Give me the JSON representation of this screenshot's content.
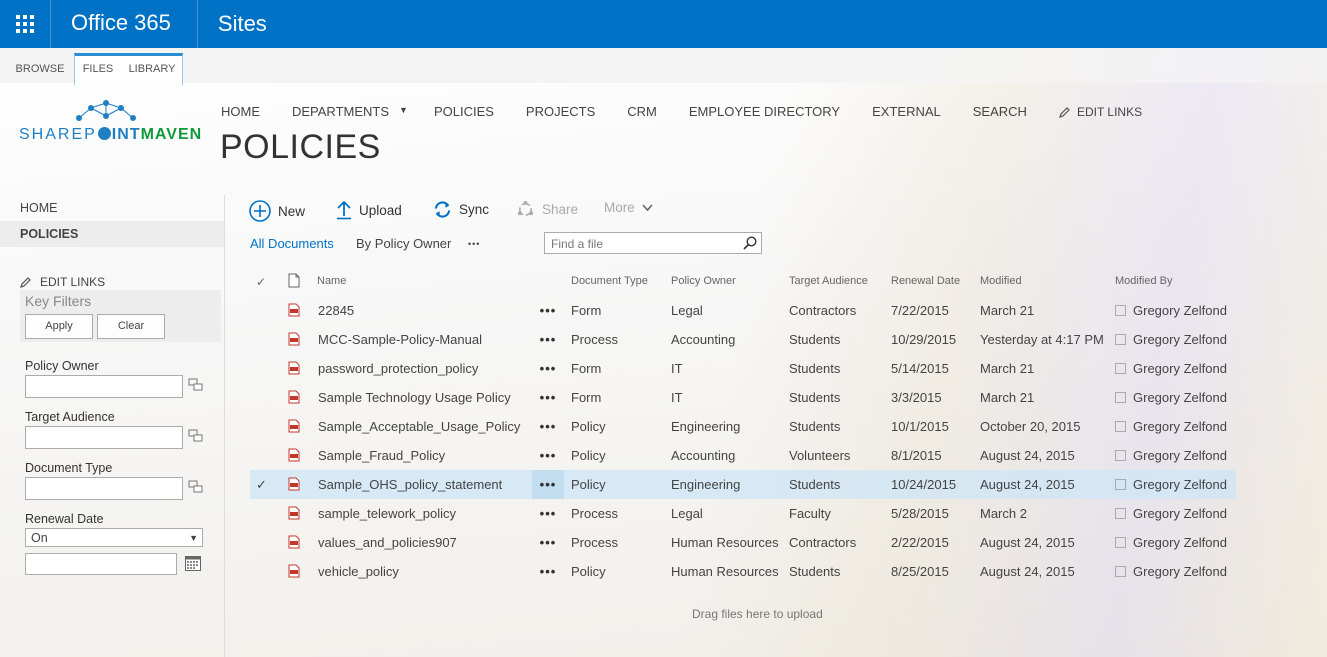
{
  "suite": {
    "brand": "Office 365",
    "app": "Sites"
  },
  "ribbon": {
    "tabs": [
      "BROWSE",
      "FILES",
      "LIBRARY"
    ]
  },
  "logo": {
    "part1": "SHAREP",
    "part2": "INT",
    "part3": "MAVEN"
  },
  "topnav": {
    "items": [
      "HOME",
      "DEPARTMENTS",
      "POLICIES",
      "PROJECTS",
      "CRM",
      "EMPLOYEE DIRECTORY",
      "EXTERNAL",
      "SEARCH"
    ],
    "edit_links": "EDIT LINKS"
  },
  "page_title": "POLICIES",
  "leftnav": {
    "items": [
      "HOME",
      "POLICIES"
    ],
    "edit_links": "EDIT LINKS"
  },
  "key_filters": {
    "title": "Key Filters",
    "apply": "Apply",
    "clear": "Clear",
    "policy_owner": "Policy Owner",
    "target_audience": "Target Audience",
    "document_type": "Document Type",
    "renewal_date": "Renewal Date",
    "renewal_operator": "On"
  },
  "commands": {
    "new": "New",
    "upload": "Upload",
    "sync": "Sync",
    "share": "Share",
    "more": "More"
  },
  "views": {
    "all": "All Documents",
    "by_owner": "By Policy Owner",
    "more": "•••"
  },
  "search": {
    "placeholder": "Find a file"
  },
  "table": {
    "headers": {
      "name": "Name",
      "doc_type": "Document Type",
      "owner": "Policy Owner",
      "audience": "Target Audience",
      "renewal": "Renewal Date",
      "modified": "Modified",
      "modified_by": "Modified By"
    },
    "rows": [
      {
        "name": "22845",
        "doc_type": "Form",
        "owner": "Legal",
        "audience": "Contractors",
        "renewal": "7/22/2015",
        "modified": "March 21",
        "modified_by": "Gregory Zelfond"
      },
      {
        "name": "MCC-Sample-Policy-Manual",
        "doc_type": "Process",
        "owner": "Accounting",
        "audience": "Students",
        "renewal": "10/29/2015",
        "modified": "Yesterday at 4:17 PM",
        "modified_by": "Gregory Zelfond"
      },
      {
        "name": "password_protection_policy",
        "doc_type": "Form",
        "owner": "IT",
        "audience": "Students",
        "renewal": "5/14/2015",
        "modified": "March 21",
        "modified_by": "Gregory Zelfond"
      },
      {
        "name": "Sample Technology Usage Policy",
        "doc_type": "Form",
        "owner": "IT",
        "audience": "Students",
        "renewal": "3/3/2015",
        "modified": "March 21",
        "modified_by": "Gregory Zelfond"
      },
      {
        "name": "Sample_Acceptable_Usage_Policy",
        "doc_type": "Policy",
        "owner": "Engineering",
        "audience": "Students",
        "renewal": "10/1/2015",
        "modified": "October 20, 2015",
        "modified_by": "Gregory Zelfond"
      },
      {
        "name": "Sample_Fraud_Policy",
        "doc_type": "Policy",
        "owner": "Accounting",
        "audience": "Volunteers",
        "renewal": "8/1/2015",
        "modified": "August 24, 2015",
        "modified_by": "Gregory Zelfond"
      },
      {
        "name": "Sample_OHS_policy_statement",
        "doc_type": "Policy",
        "owner": "Engineering",
        "audience": "Students",
        "renewal": "10/24/2015",
        "modified": "August 24, 2015",
        "modified_by": "Gregory Zelfond"
      },
      {
        "name": "sample_telework_policy",
        "doc_type": "Process",
        "owner": "Legal",
        "audience": "Faculty",
        "renewal": "5/28/2015",
        "modified": "March 2",
        "modified_by": "Gregory Zelfond"
      },
      {
        "name": "values_and_policies907",
        "doc_type": "Process",
        "owner": "Human Resources",
        "audience": "Contractors",
        "renewal": "2/22/2015",
        "modified": "August 24, 2015",
        "modified_by": "Gregory Zelfond"
      },
      {
        "name": "vehicle_policy",
        "doc_type": "Policy",
        "owner": "Human Resources",
        "audience": "Students",
        "renewal": "8/25/2015",
        "modified": "August 24, 2015",
        "modified_by": "Gregory Zelfond"
      }
    ],
    "selected_row": 6,
    "row_more": "•••"
  },
  "drag_hint": "Drag files here to upload",
  "colors": {
    "suite": "#0072c6",
    "accent": "#0072c6",
    "selected_row": "#cde6f7"
  }
}
